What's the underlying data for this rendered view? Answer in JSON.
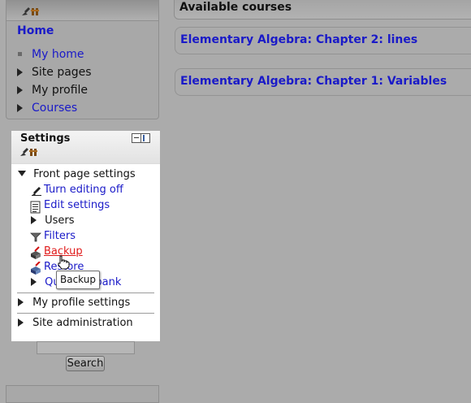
{
  "navigation": {
    "home_label": "Home",
    "items": [
      {
        "label": "My home",
        "marker": "bullet",
        "link": true
      },
      {
        "label": "Site pages",
        "marker": "expand",
        "link": false
      },
      {
        "label": "My profile",
        "marker": "expand",
        "link": false
      },
      {
        "label": "Courses",
        "marker": "expand",
        "link": true
      }
    ]
  },
  "settings": {
    "title": "Settings",
    "front_page_label": "Front page settings",
    "items": [
      {
        "label": "Turn editing off",
        "icon": "edit-pencil-icon",
        "link": true
      },
      {
        "label": "Edit settings",
        "icon": "document-icon",
        "link": true
      },
      {
        "label": "Users",
        "icon": "expand-arrow-icon",
        "link": false
      },
      {
        "label": "Filters",
        "icon": "funnel-icon",
        "link": true
      },
      {
        "label": "Backup",
        "icon": "backup-icon",
        "link": true,
        "hovered": true
      },
      {
        "label": "Restore",
        "icon": "restore-icon",
        "link": true
      },
      {
        "label": "Question bank",
        "icon": "expand-arrow-icon",
        "link": true
      }
    ],
    "my_profile_settings_label": "My profile settings",
    "site_administration_label": "Site administration"
  },
  "tooltip": {
    "text": "Backup"
  },
  "search": {
    "input_value": "",
    "button_label": "Search"
  },
  "main": {
    "header_title": "Available courses",
    "courses": [
      {
        "name": "Elementary Algebra: Chapter 2: lines"
      },
      {
        "name": "Elementary Algebra: Chapter 1: Variables"
      }
    ]
  },
  "colors": {
    "link": "#1a1ac8",
    "hover_link": "#e01b1b",
    "overlay": "#ababab",
    "highlight_bg": "#ffffff"
  }
}
